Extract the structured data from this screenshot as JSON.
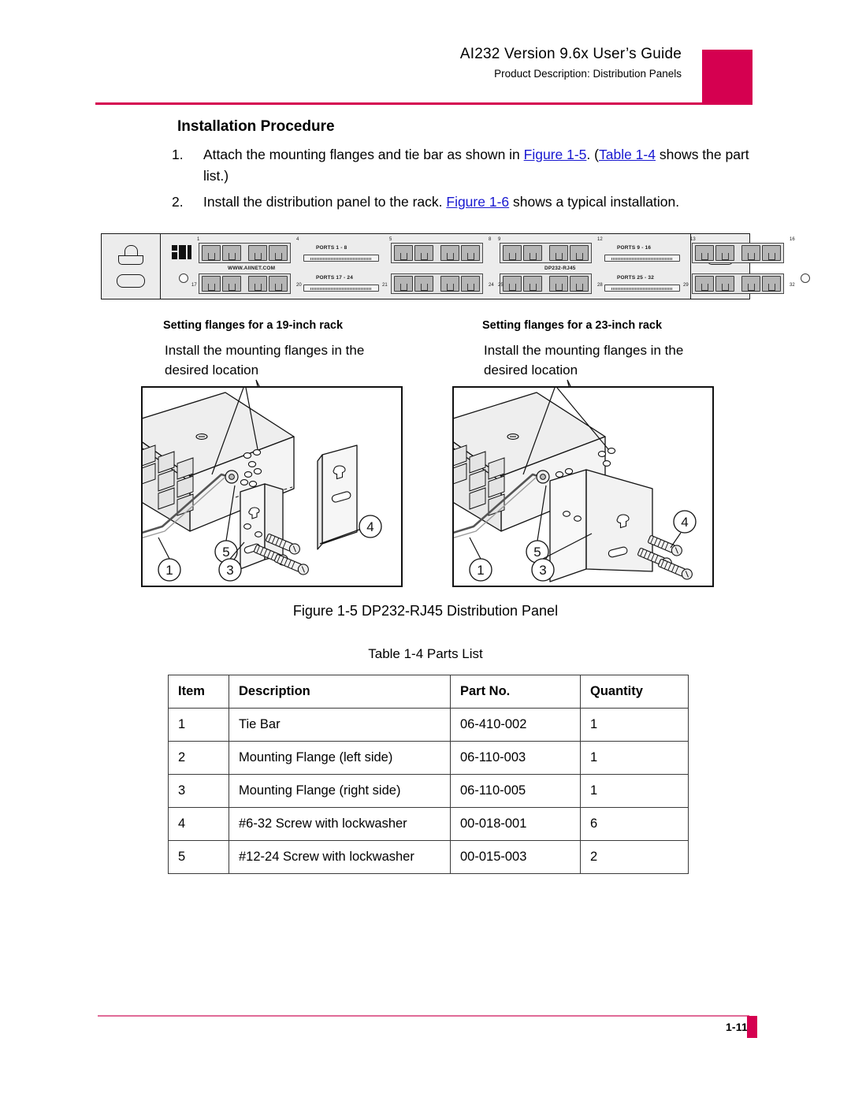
{
  "header": {
    "title": "AI232 Version 9.6x User’s Guide",
    "subtitle": "Product Description: Distribution Panels",
    "accent_color": "#d50050"
  },
  "section": {
    "heading": "Installation Procedure",
    "steps": [
      {
        "num": "1.",
        "parts": [
          {
            "t": "Attach the mounting flanges and tie bar as shown in ",
            "link": false
          },
          {
            "t": "Figure 1-5",
            "link": true
          },
          {
            "t": ". (",
            "link": false
          },
          {
            "t": "Table 1-4",
            "link": true
          },
          {
            "t": " shows the part list.)",
            "link": false
          }
        ]
      },
      {
        "num": "2.",
        "parts": [
          {
            "t": "Install the distribution panel to the rack. ",
            "link": false
          },
          {
            "t": "Figure 1-6",
            "link": true
          },
          {
            "t": " shows a typical installation.",
            "link": false
          }
        ]
      }
    ],
    "link_color": "#1818d0"
  },
  "panel": {
    "brand_url": "WWW.AIINET.COM",
    "model": "DP232-RJ45",
    "port_labels": [
      "PORTS 1 - 8",
      "PORTS 9 - 16",
      "PORTS 17 - 24",
      "PORTS 25 - 32"
    ],
    "port_numbers": [
      "1",
      "4",
      "5",
      "8",
      "9",
      "12",
      "13",
      "16",
      "17",
      "20",
      "21",
      "24",
      "25",
      "28",
      "29",
      "32"
    ]
  },
  "flange_sections": [
    {
      "heading": "Setting flanges for a 19-inch rack",
      "body": "Install the mounting flanges in the desired location",
      "callouts": [
        "4",
        "5",
        "1",
        "3"
      ]
    },
    {
      "heading": "Setting flanges for a 23-inch rack",
      "body": "Install the mounting flanges in the desired location",
      "callouts": [
        "4",
        "5",
        "1",
        "3"
      ]
    }
  ],
  "figure_caption": "Figure 1-5   DP232-RJ45 Distribution Panel",
  "table_caption": "Table 1-4   Parts List",
  "parts_table": {
    "columns": [
      "Item",
      "Description",
      "Part No.",
      "Quantity"
    ],
    "rows": [
      [
        "1",
        "Tie Bar",
        "06-410-002",
        "1"
      ],
      [
        "2",
        "Mounting Flange (left side)",
        "06-110-003",
        "1"
      ],
      [
        "3",
        "Mounting Flange (right side)",
        "06-110-005",
        "1"
      ],
      [
        "4",
        "#6-32 Screw with lockwasher",
        "00-018-001",
        "6"
      ],
      [
        "5",
        "#12-24 Screw with lockwasher",
        "00-015-003",
        "2"
      ]
    ]
  },
  "footer": {
    "page_number": "1-11",
    "rule_color": "#e06a97",
    "block_color": "#d50050"
  }
}
